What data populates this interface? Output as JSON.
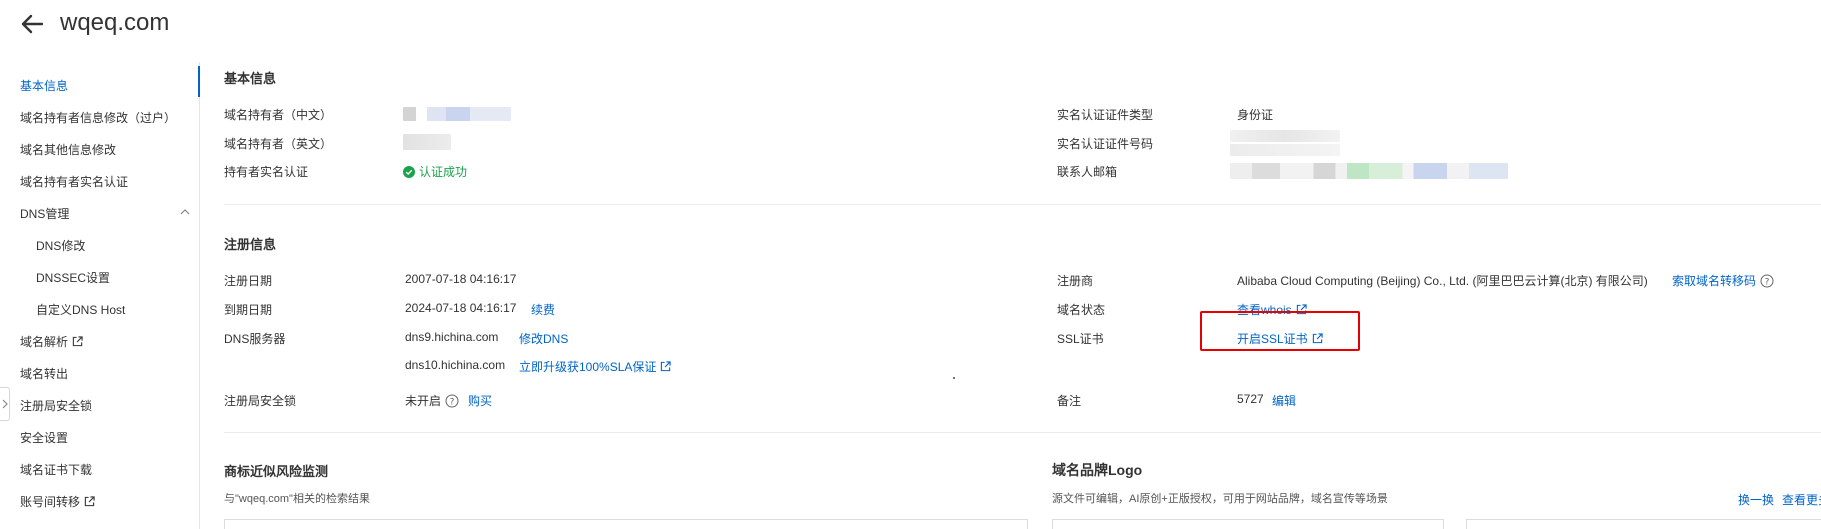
{
  "header": {
    "title": "wqeq.com"
  },
  "sidebar": {
    "items": [
      {
        "label": "基本信息"
      },
      {
        "label": "域名持有者信息修改（过户）"
      },
      {
        "label": "域名其他信息修改"
      },
      {
        "label": "域名持有者实名认证"
      },
      {
        "label": "DNS管理"
      },
      {
        "label": "DNS修改"
      },
      {
        "label": "DNSSEC设置"
      },
      {
        "label": "自定义DNS Host"
      },
      {
        "label": "域名解析"
      },
      {
        "label": "域名转出"
      },
      {
        "label": "注册局安全锁"
      },
      {
        "label": "安全设置"
      },
      {
        "label": "域名证书下载"
      },
      {
        "label": "账号间转移"
      }
    ]
  },
  "basic": {
    "title": "基本信息",
    "owner_cn_label": "域名持有者（中文）",
    "owner_en_label": "域名持有者（英文）",
    "verify_label": "持有者实名认证",
    "verify_value": "认证成功",
    "cert_type_label": "实名认证证件类型",
    "cert_type_value": "身份证",
    "cert_no_label": "实名认证证件号码",
    "email_label": "联系人邮箱"
  },
  "registration": {
    "title": "注册信息",
    "reg_date_label": "注册日期",
    "reg_date_value": "2007-07-18 04:16:17",
    "exp_date_label": "到期日期",
    "exp_date_value": "2024-07-18 04:16:17",
    "renew_link": "续费",
    "dns_label": "DNS服务器",
    "dns1": "dns9.hichina.com",
    "modify_dns_link": "修改DNS",
    "dns2": "dns10.hichina.com",
    "upgrade_link": "立即升级获100%SLA保证",
    "lock_label": "注册局安全锁",
    "lock_value": "未开启",
    "buy_link": "购买",
    "registrar_label": "注册商",
    "registrar_value": "Alibaba Cloud Computing (Beijing) Co., Ltd. (阿里巴巴云计算(北京) 有限公司)",
    "transfer_code_link": "索取域名转移码",
    "status_label": "域名状态",
    "whois_link": "查看whois",
    "ssl_label": "SSL证书",
    "ssl_link": "开启SSL证书",
    "remark_label": "备注",
    "remark_value": "5727",
    "edit_link": "编辑"
  },
  "trademark": {
    "title": "商标近似风险监测",
    "subtitle": "与\"wqeq.com\"相关的检索结果"
  },
  "brand": {
    "title": "域名品牌Logo",
    "subtitle": "源文件可编辑，AI原创+正版授权，可用于网站品牌，域名宣传等场景",
    "swap_link": "换一换",
    "more_link": "查看更多"
  },
  "colors": {
    "accent": "#0064c8",
    "success": "#1aa34a",
    "highlight": "#e60000"
  }
}
